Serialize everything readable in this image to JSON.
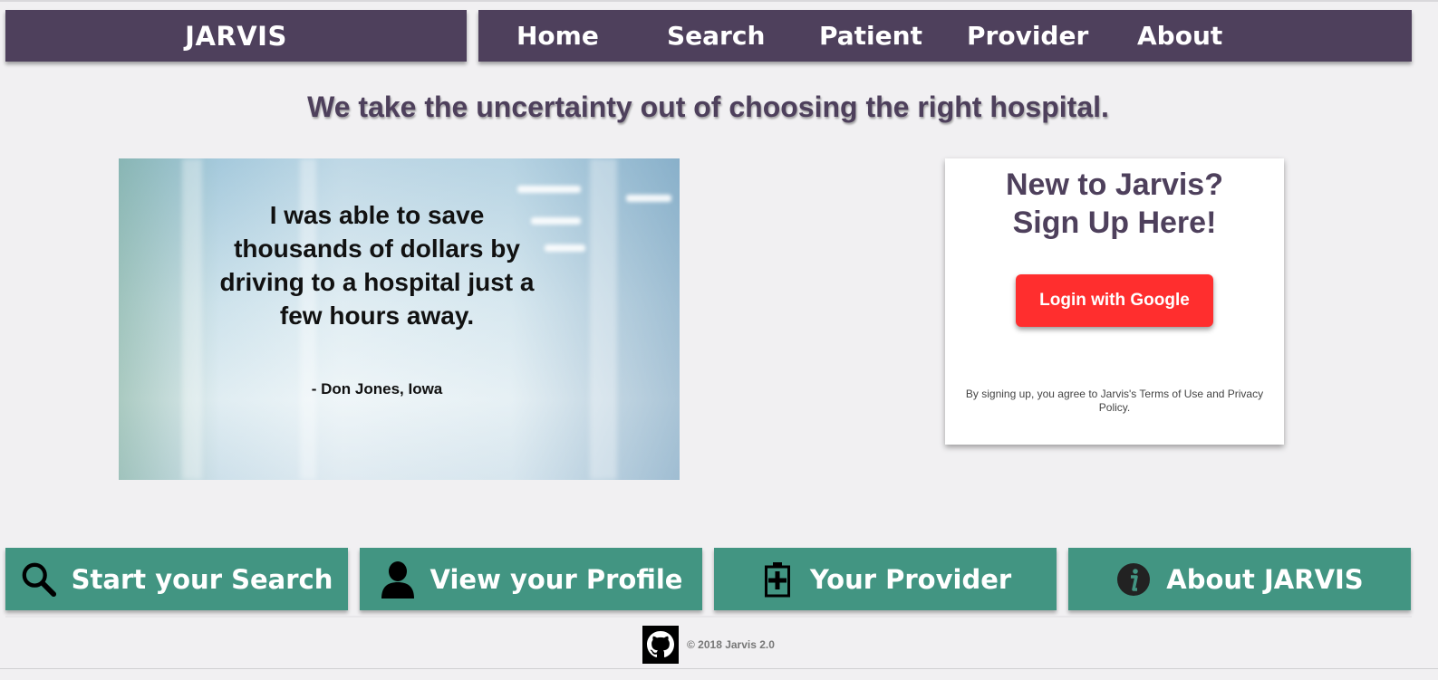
{
  "header": {
    "brand": "JARVIS",
    "nav": [
      "Home",
      "Search",
      "Patient",
      "Provider",
      "About"
    ],
    "bar_color": "#4e405c"
  },
  "tagline": "We take the uncertainty out of choosing the right hospital.",
  "testimonial": {
    "quote": "I was able to save thousands of dollars by driving to a hospital just a few hours away.",
    "author": "- Don Jones, Iowa"
  },
  "signup": {
    "title_line1": "New to Jarvis?",
    "title_line2": "Sign Up Here!",
    "button_label": "Login with Google",
    "button_color": "#ff2e2e",
    "terms": "By signing up, you agree to Jarvis's Terms of Use and Privacy Policy."
  },
  "actions": [
    {
      "label": "Start your Search",
      "icon": "search-icon"
    },
    {
      "label": "View your Profile",
      "icon": "user-icon"
    },
    {
      "label": "Your Provider",
      "icon": "medical-battery-icon"
    },
    {
      "label": "About JARVIS",
      "icon": "info-icon"
    }
  ],
  "action_color": "#429582",
  "footer": {
    "icon": "github-icon",
    "copyright": "© 2018 Jarvis 2.0"
  }
}
